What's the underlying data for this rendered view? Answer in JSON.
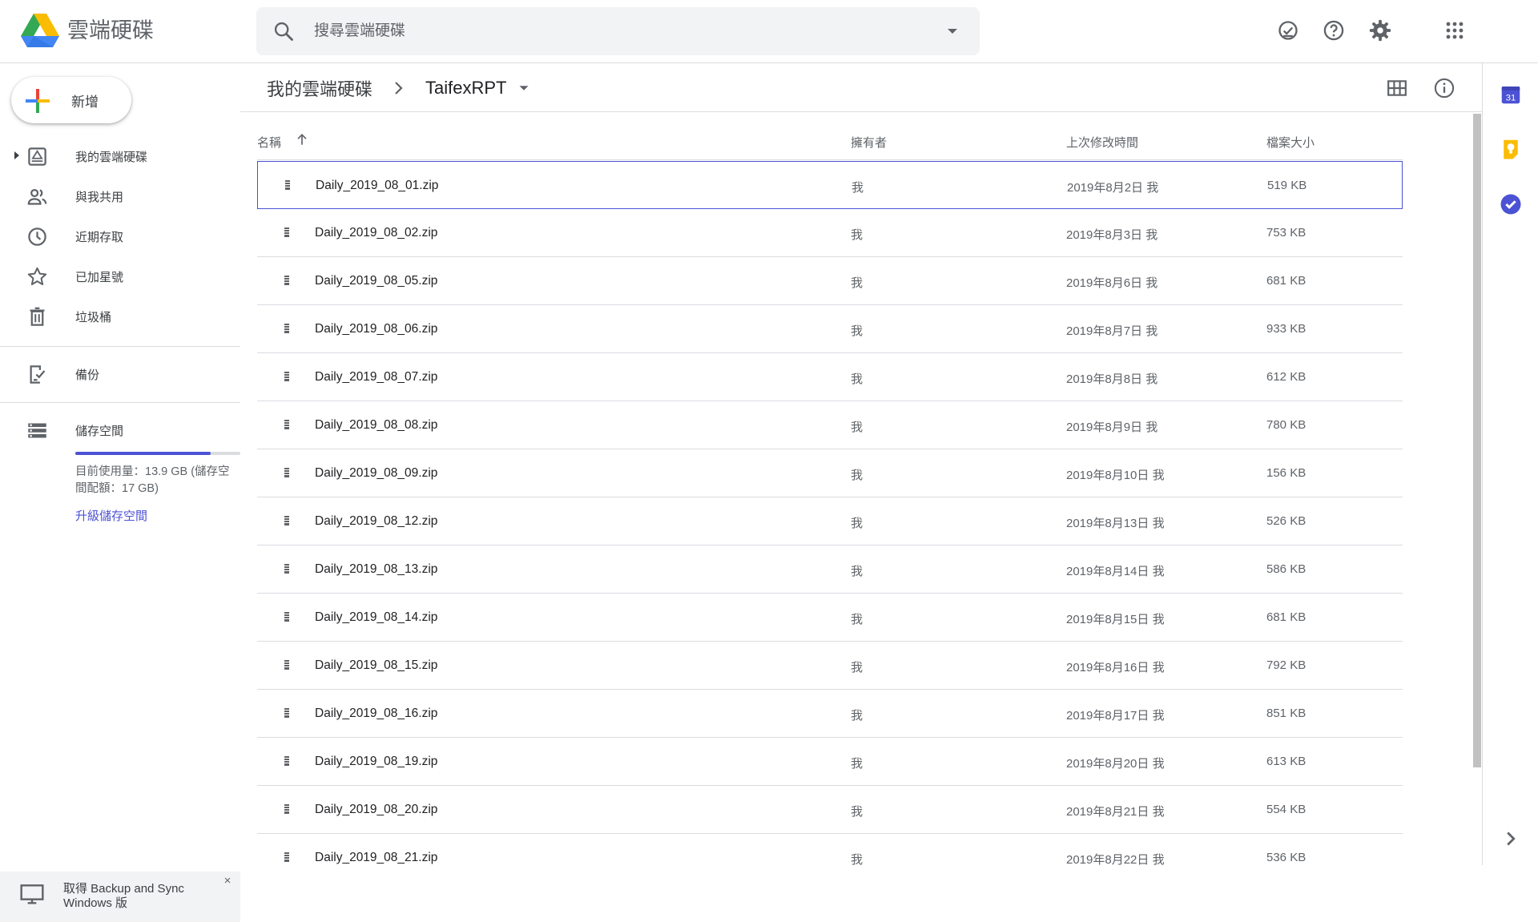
{
  "header": {
    "app_title": "雲端硬碟",
    "search_placeholder": "搜尋雲端硬碟"
  },
  "sidebar": {
    "new_label": "新增",
    "items": [
      {
        "label": "我的雲端硬碟",
        "icon": "my-drive-icon"
      },
      {
        "label": "與我共用",
        "icon": "people-icon"
      },
      {
        "label": "近期存取",
        "icon": "clock-icon"
      },
      {
        "label": "已加星號",
        "icon": "star-icon"
      },
      {
        "label": "垃圾桶",
        "icon": "trash-icon"
      },
      {
        "label": "備份",
        "icon": "backup-icon"
      },
      {
        "label": "儲存空間",
        "icon": "storage-icon"
      }
    ],
    "storage_used_fraction": 0.82,
    "storage_text": "目前使用量：13.9 GB (儲存空間配額：17 GB)",
    "upgrade_label": "升級儲存空間",
    "promo_text": "取得 Backup and Sync Windows 版",
    "promo_close": "×"
  },
  "breadcrumb": {
    "root": "我的雲端硬碟",
    "current": "TaifexRPT"
  },
  "file_list": {
    "headers": {
      "name": "名稱",
      "owner": "擁有者",
      "modified": "上次修改時間",
      "size": "檔案大小"
    },
    "rows": [
      {
        "name": "Daily_2019_08_01.zip",
        "owner": "我",
        "modified": "2019年8月2日 我",
        "size": "519 KB"
      },
      {
        "name": "Daily_2019_08_02.zip",
        "owner": "我",
        "modified": "2019年8月3日 我",
        "size": "753 KB"
      },
      {
        "name": "Daily_2019_08_05.zip",
        "owner": "我",
        "modified": "2019年8月6日 我",
        "size": "681 KB"
      },
      {
        "name": "Daily_2019_08_06.zip",
        "owner": "我",
        "modified": "2019年8月7日 我",
        "size": "933 KB"
      },
      {
        "name": "Daily_2019_08_07.zip",
        "owner": "我",
        "modified": "2019年8月8日 我",
        "size": "612 KB"
      },
      {
        "name": "Daily_2019_08_08.zip",
        "owner": "我",
        "modified": "2019年8月9日 我",
        "size": "780 KB"
      },
      {
        "name": "Daily_2019_08_09.zip",
        "owner": "我",
        "modified": "2019年8月10日 我",
        "size": "156 KB"
      },
      {
        "name": "Daily_2019_08_12.zip",
        "owner": "我",
        "modified": "2019年8月13日 我",
        "size": "526 KB"
      },
      {
        "name": "Daily_2019_08_13.zip",
        "owner": "我",
        "modified": "2019年8月14日 我",
        "size": "586 KB"
      },
      {
        "name": "Daily_2019_08_14.zip",
        "owner": "我",
        "modified": "2019年8月15日 我",
        "size": "681 KB"
      },
      {
        "name": "Daily_2019_08_15.zip",
        "owner": "我",
        "modified": "2019年8月16日 我",
        "size": "792 KB"
      },
      {
        "name": "Daily_2019_08_16.zip",
        "owner": "我",
        "modified": "2019年8月17日 我",
        "size": "851 KB"
      },
      {
        "name": "Daily_2019_08_19.zip",
        "owner": "我",
        "modified": "2019年8月20日 我",
        "size": "613 KB"
      },
      {
        "name": "Daily_2019_08_20.zip",
        "owner": "我",
        "modified": "2019年8月21日 我",
        "size": "554 KB"
      },
      {
        "name": "Daily_2019_08_21.zip",
        "owner": "我",
        "modified": "2019年8月22日 我",
        "size": "536 KB"
      }
    ]
  },
  "side_panel": {
    "calendar_day": "31"
  },
  "colors": {
    "accent": "#4c52d4",
    "divider": "#dadce0",
    "search_bg": "#f1f3f4",
    "text_secondary": "#5f6368"
  }
}
